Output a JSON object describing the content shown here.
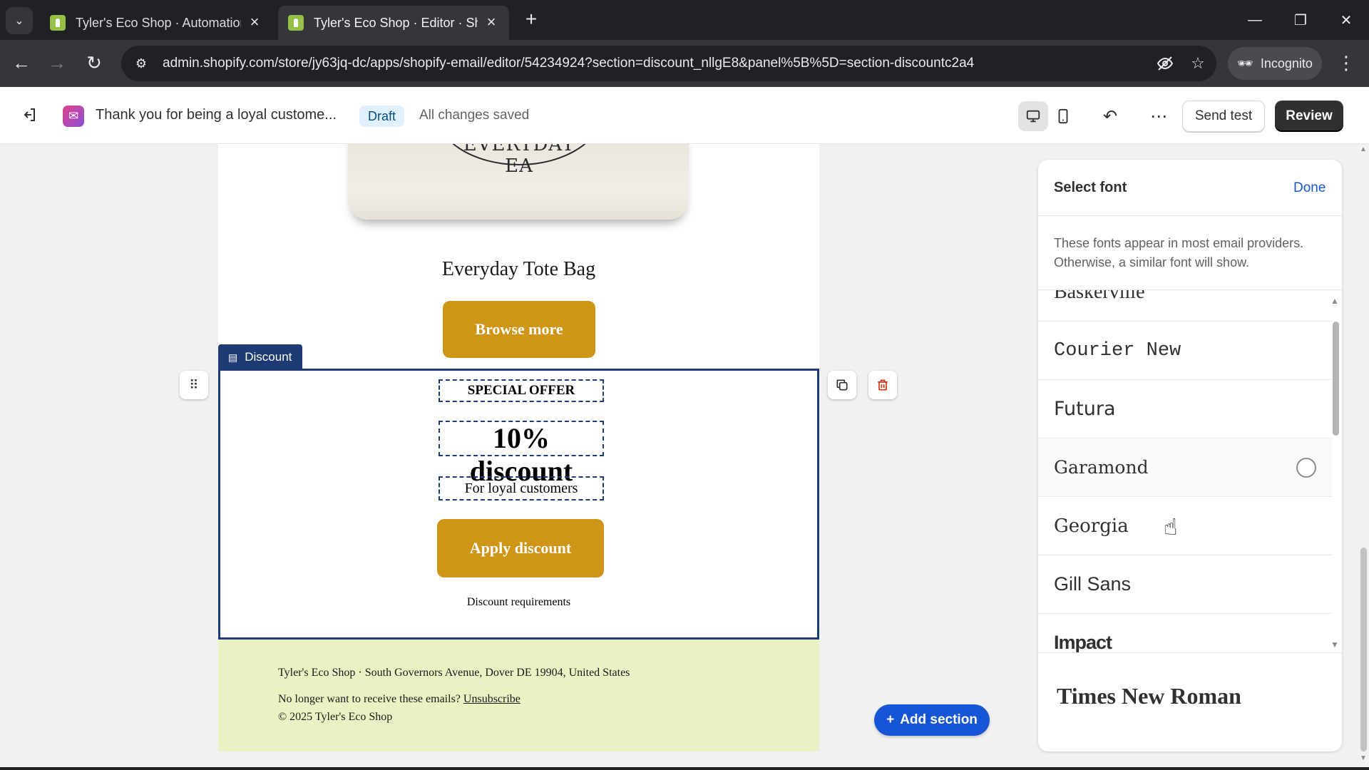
{
  "browser": {
    "tabs": [
      {
        "title": "Tyler's Eco Shop · Automations",
        "active": false
      },
      {
        "title": "Tyler's Eco Shop · Editor · Shopify",
        "active": true
      }
    ],
    "url": "admin.shopify.com/store/jy63jq-dc/apps/shopify-email/editor/54234924?section=discount_nllgE8&panel%5B%5D=section-discountc2a4",
    "incognito_label": "Incognito",
    "icons": {
      "tab_search": "chevron-down-icon",
      "new_tab": "plus-icon",
      "back": "arrow-left-icon",
      "forward": "arrow-right-icon",
      "reload": "reload-icon",
      "site_info": "tune-icon",
      "eye_off": "eye-off-icon",
      "bookmark": "star-icon",
      "menu": "kebab-icon"
    }
  },
  "editor": {
    "email_title": "Thank you for being a loyal custome...",
    "status_badge": "Draft",
    "save_status": "All changes saved",
    "send_test_label": "Send test",
    "review_label": "Review"
  },
  "email": {
    "tote_logo_text": "EVERYDAY EA",
    "product_name": "Everyday Tote Bag",
    "browse_button": "Browse more",
    "discount_section": {
      "label": "Discount",
      "heading": "SPECIAL OFFER",
      "amount": "10% discount",
      "subheading": "For loyal customers",
      "button": "Apply discount",
      "requirements": "Discount requirements"
    },
    "footer": {
      "address": "Tyler's Eco Shop · South Governors Avenue, Dover DE 19904, United States",
      "unsubscribe_prefix": "No longer want to receive these emails?",
      "unsubscribe_link": "Unsubscribe",
      "copyright": "© 2025 Tyler's Eco Shop"
    }
  },
  "add_section_label": "Add section",
  "font_panel": {
    "title": "Select font",
    "done_label": "Done",
    "note": "These fonts appear in most email providers. Otherwise, a similar font will show.",
    "fonts": [
      "Baskerville",
      "Courier New",
      "Futura",
      "Garamond",
      "Georgia",
      "Gill Sans",
      "Impact"
    ],
    "selected_font": "Times New Roman"
  },
  "colors": {
    "accent_gold": "#cf9517",
    "section_navy": "#1f3b75",
    "primary_blue": "#1656d6",
    "footer_bg": "#e9f2c3"
  }
}
